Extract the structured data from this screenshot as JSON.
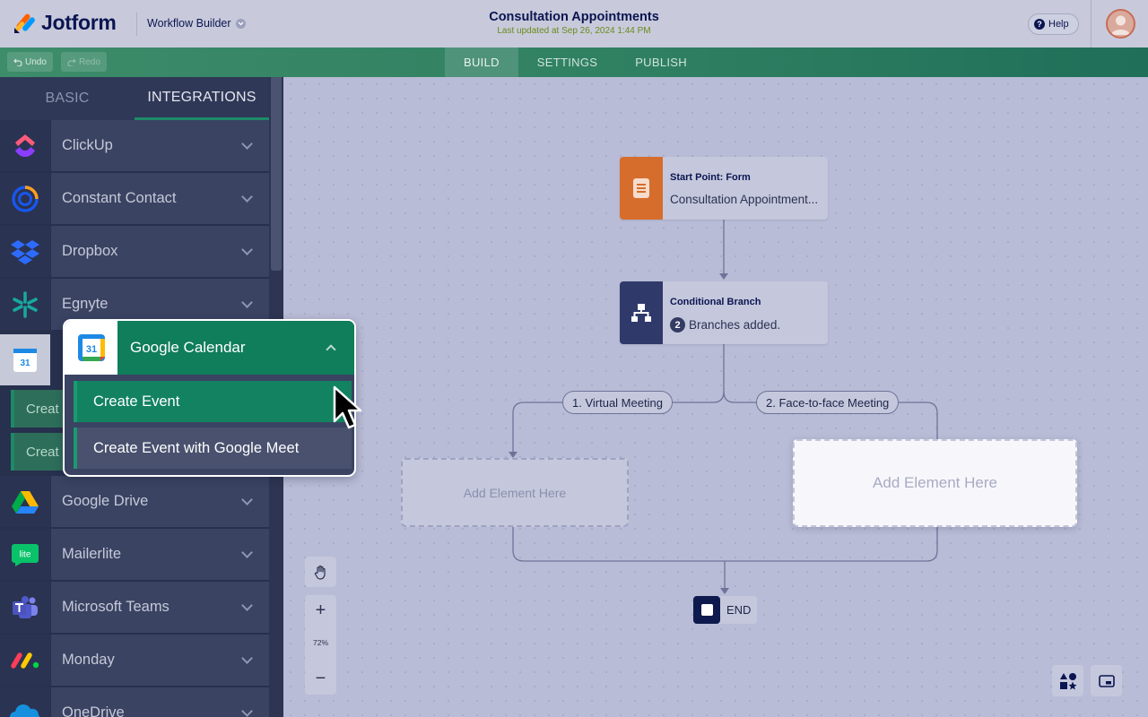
{
  "header": {
    "brand": "Jotform",
    "product_switcher": "Workflow Builder",
    "title": "Consultation Appointments",
    "last_updated": "Last updated at Sep 26, 2024 1:44 PM",
    "help_label": "Help"
  },
  "toolbar": {
    "undo_label": "Undo",
    "redo_label": "Redo",
    "tabs": [
      "BUILD",
      "SETTINGS",
      "PUBLISH"
    ],
    "active_tab": "BUILD"
  },
  "sidebar": {
    "tabs": [
      "BASIC",
      "INTEGRATIONS"
    ],
    "active_tab": "INTEGRATIONS",
    "items": [
      {
        "label": "ClickUp",
        "icon": "clickup-icon"
      },
      {
        "label": "Constant Contact",
        "icon": "constant-contact-icon"
      },
      {
        "label": "Dropbox",
        "icon": "dropbox-icon"
      },
      {
        "label": "Egnyte",
        "icon": "egnyte-icon"
      },
      {
        "label": "Google Drive",
        "icon": "google-drive-icon"
      },
      {
        "label": "Mailerlite",
        "icon": "mailerlite-icon"
      },
      {
        "label": "Microsoft Teams",
        "icon": "microsoft-teams-icon"
      },
      {
        "label": "Monday",
        "icon": "monday-icon"
      },
      {
        "label": "OneDrive",
        "icon": "onedrive-icon"
      }
    ],
    "partial_sub_labels": [
      "Creat",
      "Creat"
    ]
  },
  "popup": {
    "title": "Google Calendar",
    "calendar_number": "31",
    "actions": [
      "Create Event",
      "Create Event with Google Meet"
    ],
    "highlighted": "Create Event"
  },
  "flow": {
    "start": {
      "title": "Start Point: Form",
      "subtitle": "Consultation Appointment..."
    },
    "branch": {
      "title": "Conditional Branch",
      "count": "2",
      "subtitle": "Branches added."
    },
    "branch_labels": [
      "1. Virtual Meeting",
      "2. Face-to-face Meeting"
    ],
    "add_element": "Add Element Here",
    "end_label": "END"
  },
  "controls": {
    "zoom_level": "72%",
    "zoom_in": "+",
    "zoom_out": "−"
  },
  "colors": {
    "brand_navy": "#0a1551",
    "accent_green": "#107d5b",
    "form_orange": "#d66d2c",
    "branch_navy": "#2f3a6b"
  }
}
